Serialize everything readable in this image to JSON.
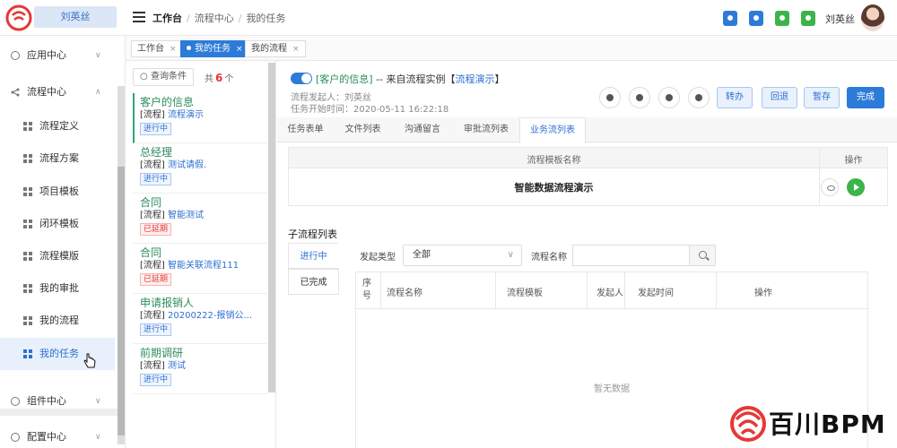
{
  "header": {
    "user_name": "刘英丝",
    "breadcrumb": [
      "工作台",
      "流程中心",
      "我的任务"
    ],
    "icon_colors": [
      "#2d7bd8",
      "#2d7bd8",
      "#3cb44b",
      "#3cb44b"
    ],
    "display_name": "刘英丝"
  },
  "sidebar": {
    "items": [
      {
        "label": "应用中心",
        "icon": "app-center-icon",
        "expanded": false
      },
      {
        "label": "流程中心",
        "icon": "share-icon",
        "expanded": true
      },
      {
        "label": "流程定义",
        "icon": "grid-icon"
      },
      {
        "label": "流程方案",
        "icon": "grid-icon"
      },
      {
        "label": "项目模板",
        "icon": "grid-icon"
      },
      {
        "label": "闭环模板",
        "icon": "grid-icon"
      },
      {
        "label": "流程模版",
        "icon": "grid-icon"
      },
      {
        "label": "我的审批",
        "icon": "grid-icon"
      },
      {
        "label": "我的流程",
        "icon": "grid-icon"
      },
      {
        "label": "我的任务",
        "icon": "grid-icon",
        "active": true
      },
      {
        "label": "组件中心",
        "icon": "gear-icon",
        "expanded": false
      },
      {
        "label": "配置中心",
        "icon": "gear-icon",
        "expanded": false
      }
    ]
  },
  "tabs": [
    {
      "label": "工作台",
      "active": false
    },
    {
      "label": "我的任务",
      "active": true
    },
    {
      "label": "我的流程",
      "active": false
    }
  ],
  "task_list": {
    "query_label": "查询条件",
    "count_prefix": "共",
    "count": "6",
    "count_suffix": "个",
    "items": [
      {
        "title": "客户的信息",
        "prefix": "[流程]",
        "name": "流程演示",
        "status": "进行中",
        "status_type": "run"
      },
      {
        "title": "总经理",
        "prefix": "[流程]",
        "name": "测试请假.",
        "status": "进行中",
        "status_type": "run"
      },
      {
        "title": "合同",
        "prefix": "[流程]",
        "name": "智能测试",
        "status": "已延期",
        "status_type": "late"
      },
      {
        "title": "合同",
        "prefix": "[流程]",
        "name": "智能关联流程111",
        "status": "已延期",
        "status_type": "late"
      },
      {
        "title": "申请报销人",
        "prefix": "[流程]",
        "name": "20200222-报销公...",
        "status": "进行中",
        "status_type": "run"
      },
      {
        "title": "前期调研",
        "prefix": "[流程]",
        "name": "测试",
        "status": "进行中",
        "status_type": "run"
      }
    ]
  },
  "detail": {
    "headline_task": "[客户的信息]",
    "headline_mid": " -- 来自流程实例【",
    "headline_flow": "流程演示",
    "headline_end": "】",
    "initiator": "流程发起人：刘英丝",
    "start_time": "任务开始时间：2020-05-11 16:22:18",
    "buttons": {
      "transfer": "转办",
      "back": "回退",
      "save": "暂存",
      "finish": "完成"
    },
    "tabs": [
      "任务表单",
      "文件列表",
      "沟通留言",
      "审批流列表",
      "业务流列表"
    ],
    "active_tab": "业务流列表",
    "template_table": {
      "col_name": "流程模板名称",
      "col_ops": "操作",
      "rows": [
        "智能数据流程演示"
      ]
    },
    "subflow": {
      "title": "子流程列表",
      "state_tabs": [
        "进行中",
        "已完成"
      ],
      "filter_type_label": "发起类型",
      "filter_type_value": "全部",
      "filter_name_label": "流程名称",
      "filter_name_placeholder": "",
      "columns": [
        "序号",
        "流程名称",
        "流程模板",
        "发起人",
        "发起时间",
        "操作"
      ],
      "empty": "暂无数据"
    }
  },
  "brand": {
    "text": "百川BPM",
    "color": "#e53935"
  }
}
